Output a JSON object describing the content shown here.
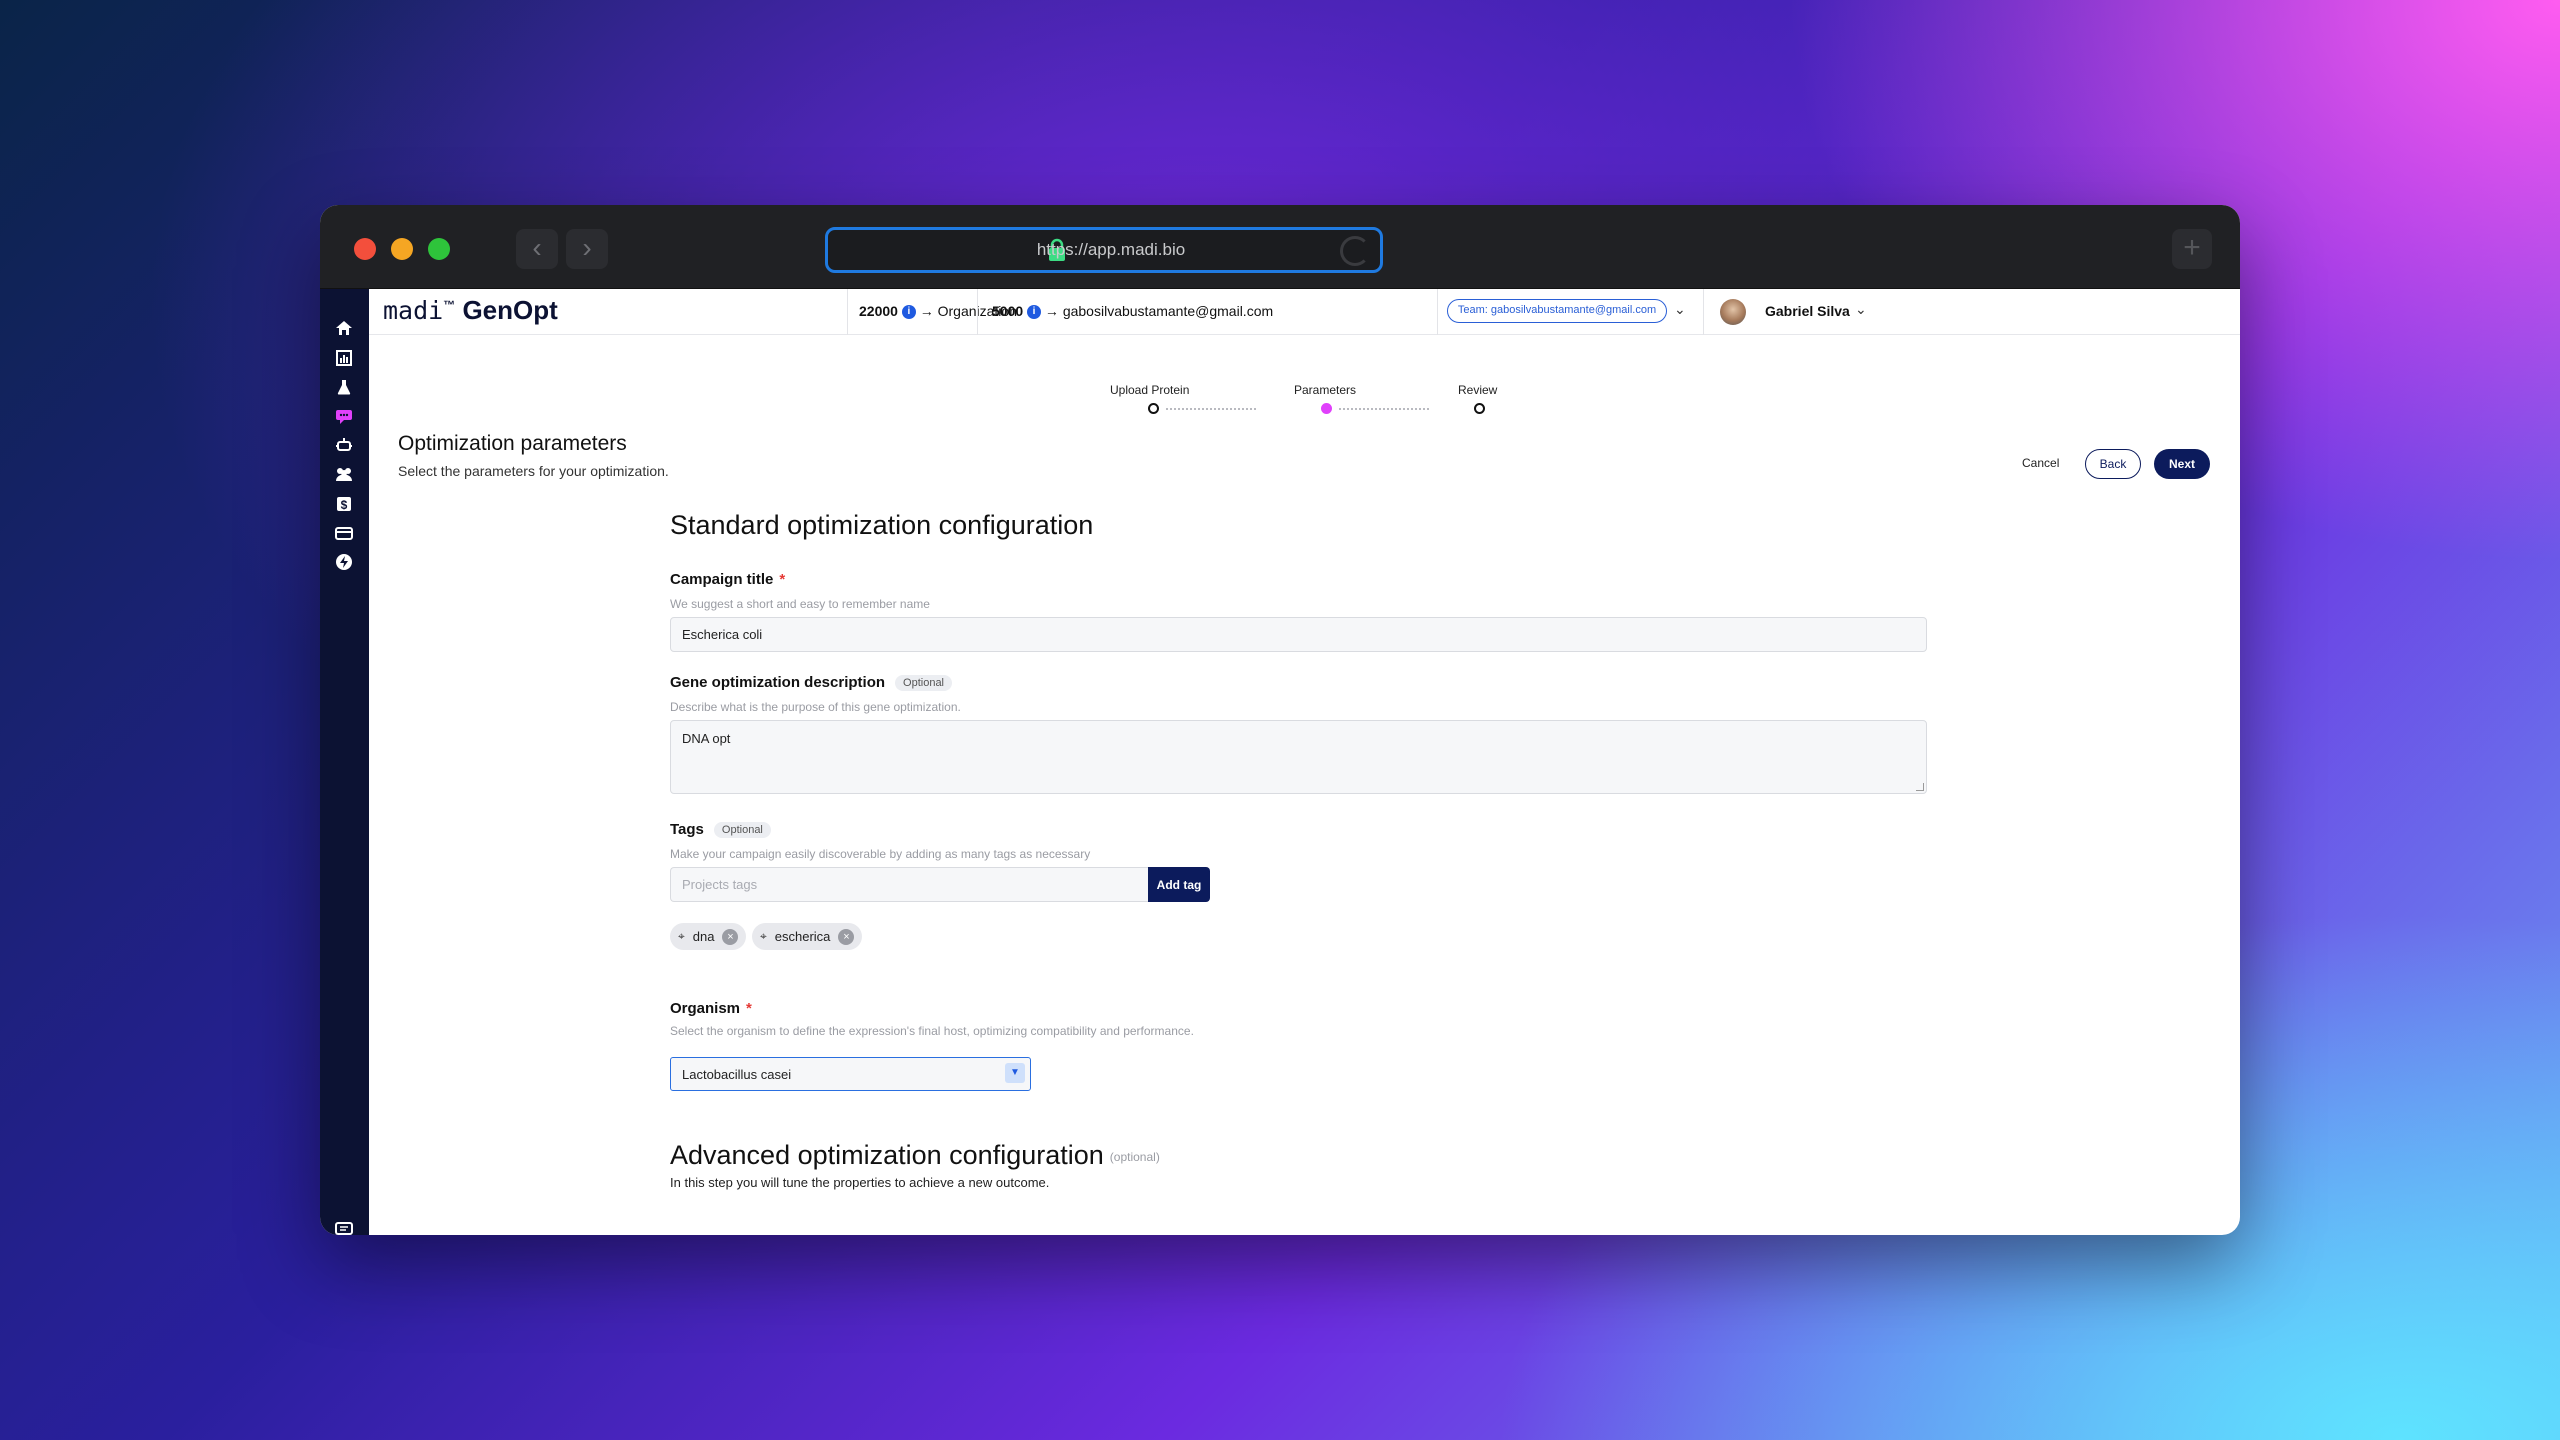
{
  "browser": {
    "url": "https://app.madi.bio"
  },
  "header": {
    "logo_mark": "madi",
    "logo_tm": "™",
    "app_name": "GenOpt",
    "org_credits": "22000",
    "org_label": "Organization",
    "user_credits": "5000",
    "user_email": "gabosilvabustamante@gmail.com",
    "team_label": "Team: gabosilvabustamante@gmail.com",
    "username": "Gabriel Silva"
  },
  "sidebar": {
    "icons": [
      "home-icon",
      "chart-icon",
      "flask-icon",
      "chat-active-icon",
      "robot-icon",
      "team-icon",
      "billing-icon",
      "card-icon",
      "bolt-icon",
      "feedback-icon",
      "collapse-icon"
    ]
  },
  "stepper": {
    "steps": [
      "Upload Protein",
      "Parameters",
      "Review"
    ],
    "active_index": 1,
    "active_color": "#e040fb"
  },
  "page": {
    "title": "Optimization parameters",
    "subtitle": "Select the parameters for your optimization.",
    "cancel_label": "Cancel",
    "back_label": "Back",
    "next_label": "Next"
  },
  "form": {
    "section_title": "Standard optimization configuration",
    "campaign": {
      "label": "Campaign title",
      "required_mark": "*",
      "hint": "We suggest a short and easy to remember name",
      "value": "Escherica coli"
    },
    "description": {
      "label": "Gene optimization description",
      "optional": "Optional",
      "hint": "Describe what is the purpose of this gene optimization.",
      "value": "DNA opt"
    },
    "tags": {
      "label": "Tags",
      "optional": "Optional",
      "hint": "Make your campaign easily discoverable by adding as many tags as necessary",
      "placeholder": "Projects tags",
      "add_label": "Add tag",
      "items": [
        "dna",
        "escherica"
      ]
    },
    "organism": {
      "label": "Organism",
      "required_mark": "*",
      "hint": "Select the organism to define the expression's final host, optimizing compatibility and performance.",
      "value": "Lactobacillus casei"
    },
    "advanced": {
      "title": "Advanced optimization configuration",
      "optional": "(optional)",
      "subtitle": "In this step you will tune the properties to achieve a new outcome."
    }
  },
  "colors": {
    "primary": "#0c1b5c",
    "sidebar": "#0c1233",
    "accent": "#e040fb",
    "link": "#2a5fd6"
  }
}
